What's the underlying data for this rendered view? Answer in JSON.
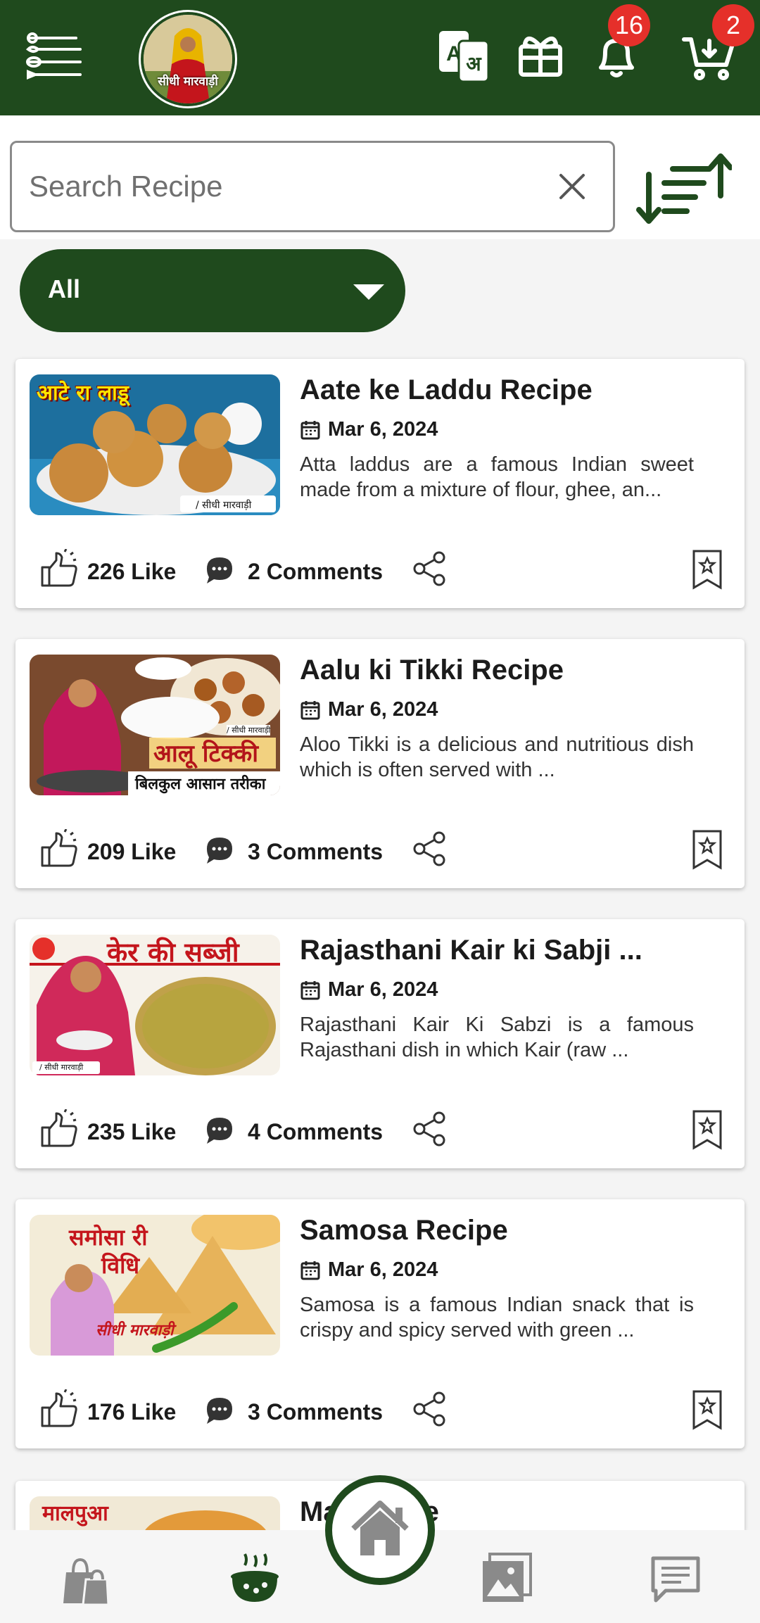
{
  "header": {
    "logo_text": "सीधी मारवाड़ी",
    "notification_count": "16",
    "cart_count": "2",
    "icons": [
      "menu-icon",
      "translate-icon",
      "gift-icon",
      "bell-icon",
      "cart-icon"
    ]
  },
  "search": {
    "placeholder": "Search Recipe"
  },
  "filter": {
    "selected": "All"
  },
  "recipes": [
    {
      "title": "Aate ke Laddu Recipe",
      "date": "Mar 6, 2024",
      "description": "Atta laddus are a famous Indian sweet made from a mixture of flour, ghee, an...",
      "likes": "226 Like",
      "comments": "2 Comments",
      "thumb_caption": "आटे रा लाडू",
      "thumb_credit": "/ सीधी मारवाड़ी"
    },
    {
      "title": "Aalu ki Tikki Recipe",
      "date": "Mar 6, 2024",
      "description": "Aloo Tikki is a delicious and nutritious dish which is often served with ...",
      "likes": "209 Like",
      "comments": "3 Comments",
      "thumb_caption": "आलू टिक्की",
      "thumb_caption_sub": "बिलकुल आसान तरीका",
      "thumb_credit": "/ सीधी मारवाड़ी"
    },
    {
      "title": "Rajasthani Kair ki Sabji ...",
      "date": "Mar 6, 2024",
      "description": "Rajasthani Kair Ki Sabzi is a famous Rajasthani dish in which Kair (raw ...",
      "likes": "235 Like",
      "comments": "4 Comments",
      "thumb_caption": "केर की सब्जी",
      "thumb_credit": "/ सीधी मारवाड़ी"
    },
    {
      "title": "Samosa Recipe",
      "date": "Mar 6, 2024",
      "description": "Samosa is a famous Indian snack that is crispy and spicy served with green ...",
      "likes": "176 Like",
      "comments": "3 Comments",
      "thumb_caption": "समोसा री",
      "thumb_caption_sub": "विधि",
      "thumb_credit": "सीधी मारवाड़ी"
    },
    {
      "title": "Ma   Recipe",
      "thumb_caption": "मालपुआ"
    }
  ],
  "bottom_nav": {
    "items": [
      "shopping-bag-icon",
      "recipe-pot-icon",
      "home-icon",
      "gallery-icon",
      "chat-icon"
    ],
    "active": "recipe-pot-icon"
  },
  "colors": {
    "brand_green": "#1f4a1d",
    "badge_red": "#e5302a",
    "icon_gray": "#8a8a8a"
  }
}
